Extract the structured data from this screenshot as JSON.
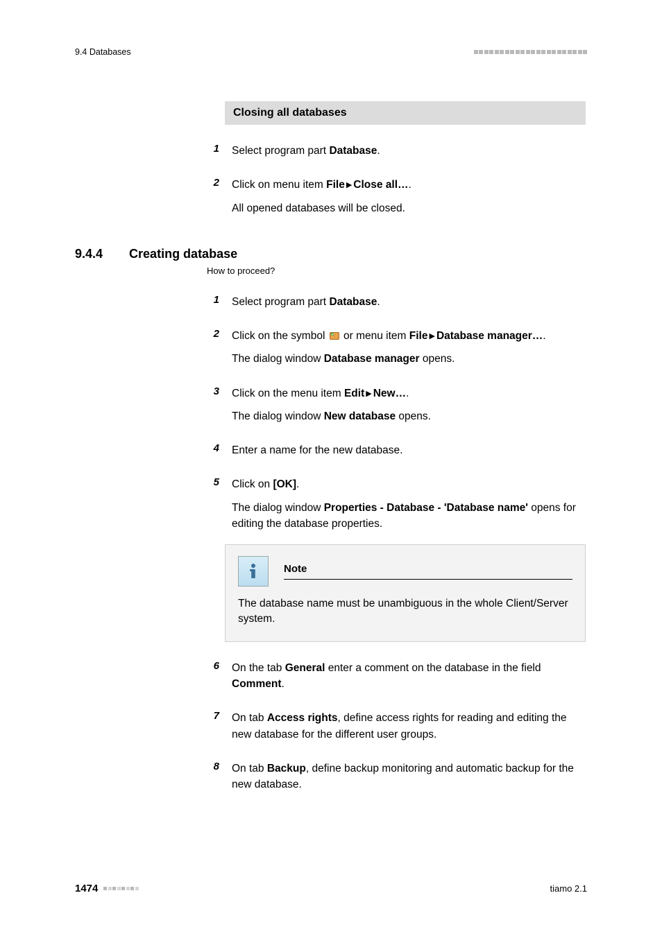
{
  "header": {
    "section_path": "9.4 Databases"
  },
  "section_closing": {
    "title": "Closing all databases",
    "steps": [
      {
        "num": "1",
        "parts": [
          {
            "t": "Select program part "
          },
          {
            "t": "Database",
            "b": true
          },
          {
            "t": "."
          }
        ]
      },
      {
        "num": "2",
        "parts": [
          {
            "t": "Click on menu item "
          },
          {
            "t": "File",
            "b": true
          },
          {
            "arrow": true
          },
          {
            "t": "Close all…",
            "b": true
          },
          {
            "t": "."
          }
        ],
        "after": "All opened databases will be closed."
      }
    ]
  },
  "section_creating": {
    "num": "9.4.4",
    "title": "Creating database",
    "howto": "How to proceed?",
    "steps": [
      {
        "num": "1",
        "parts": [
          {
            "t": "Select program part "
          },
          {
            "t": "Database",
            "b": true
          },
          {
            "t": "."
          }
        ]
      },
      {
        "num": "2",
        "parts": [
          {
            "t": "Click on the symbol "
          },
          {
            "icon": "db-manager-icon"
          },
          {
            "t": " or menu item "
          },
          {
            "t": "File",
            "b": true
          },
          {
            "arrow": true
          },
          {
            "t": "Database manager…",
            "b": true
          },
          {
            "t": "."
          }
        ],
        "after_parts": [
          {
            "t": "The dialog window "
          },
          {
            "t": "Database manager",
            "b": true
          },
          {
            "t": " opens."
          }
        ]
      },
      {
        "num": "3",
        "parts": [
          {
            "t": "Click on the menu item "
          },
          {
            "t": "Edit",
            "b": true
          },
          {
            "arrow": true
          },
          {
            "t": "New…",
            "b": true
          },
          {
            "t": "."
          }
        ],
        "after_parts": [
          {
            "t": "The dialog window "
          },
          {
            "t": "New database",
            "b": true
          },
          {
            "t": " opens."
          }
        ]
      },
      {
        "num": "4",
        "parts": [
          {
            "t": "Enter a name for the new database."
          }
        ]
      },
      {
        "num": "5",
        "parts": [
          {
            "t": "Click on "
          },
          {
            "t": "[OK]",
            "b": true
          },
          {
            "t": "."
          }
        ],
        "after_parts": [
          {
            "t": "The dialog window "
          },
          {
            "t": "Properties - Database - 'Database name'",
            "b": true
          },
          {
            "t": " opens for editing the database properties."
          }
        ]
      },
      {
        "num": "6",
        "parts": [
          {
            "t": "On the tab "
          },
          {
            "t": "General",
            "b": true
          },
          {
            "t": " enter a comment on the database in the field "
          },
          {
            "t": "Comment",
            "b": true
          },
          {
            "t": "."
          }
        ]
      },
      {
        "num": "7",
        "parts": [
          {
            "t": "On tab "
          },
          {
            "t": "Access rights",
            "b": true
          },
          {
            "t": ", define access rights for reading and editing the new database for the different user groups."
          }
        ]
      },
      {
        "num": "8",
        "parts": [
          {
            "t": "On tab "
          },
          {
            "t": "Backup",
            "b": true
          },
          {
            "t": ", define backup monitoring and automatic backup for the new database."
          }
        ]
      }
    ],
    "note": {
      "title": "Note",
      "body": "The database name must be unambiguous in the whole Client/Server system."
    }
  },
  "footer": {
    "page": "1474",
    "product": "tiamo 2.1"
  }
}
